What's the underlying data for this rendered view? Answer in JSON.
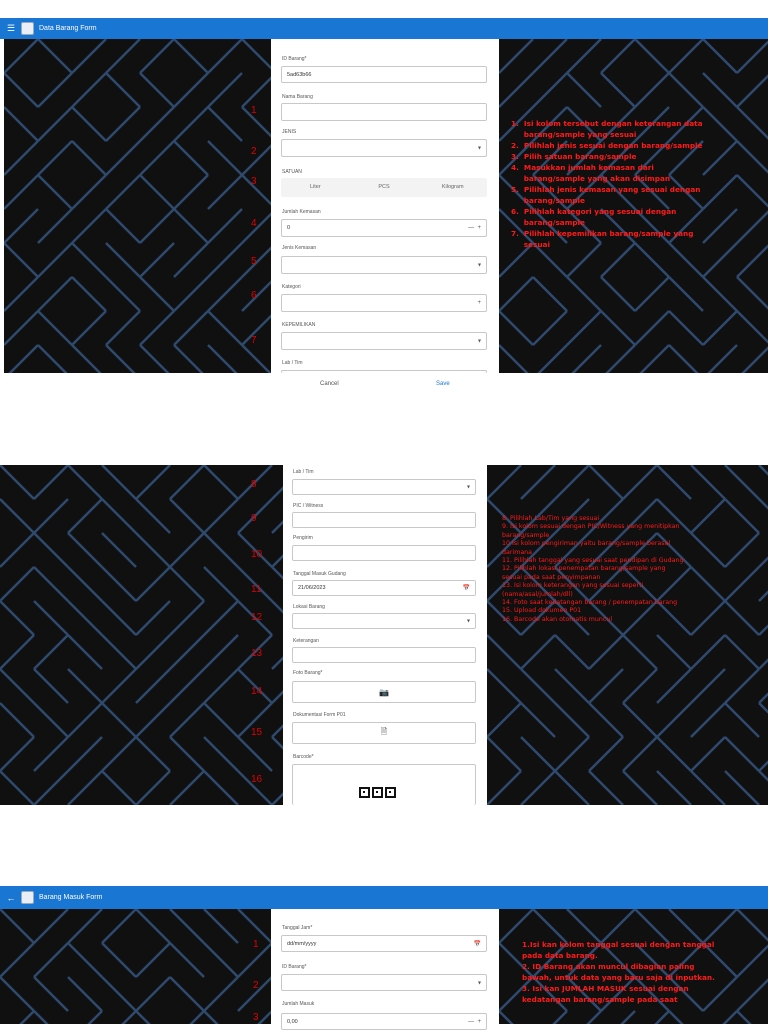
{
  "panel1": {
    "title": "Data Barang Form",
    "labels": {
      "id_barang": "ID Barang*",
      "nama_barang": "Nama Barang",
      "jenis": "JENIS",
      "satuan": "SATUAN",
      "jumlah_kemasan": "Jumlah Kemasan",
      "jenis_kemasan": "Jenis Kemasan",
      "kategori": "Kategori",
      "kepemilikan": "KEPEMILIKAN",
      "lab_tim": "Lab / Tim"
    },
    "values": {
      "id_barang": "5ad63b66",
      "jumlah_kemasan": "0"
    },
    "satuan_options": [
      "Liter",
      "PCS",
      "Kilogram"
    ],
    "actions": {
      "cancel": "Cancel",
      "save": "Save"
    },
    "numbers": [
      "1",
      "2",
      "3",
      "4",
      "5",
      "6",
      "7"
    ],
    "notes": [
      "1.  Isi kolom tersebut dengan keterangan data\n     barang/sample yang sesuai",
      "2.  Pilihlah jenis sesuai dengan barang/sample",
      "3.  Pilih satuan barang/sample",
      "4.  Masukkan jumlah kemasan dari\n     barang/sample yang akan disimpan",
      "5.  Pilihlah jenis kemasan yang sesuai dengan\n     barang/sample",
      "6.  Pilihlah kategori yang sesuai dengan\n     barang/sample",
      "7.  Pilihlah kepemilikan barang/sample yang\n     sesuai"
    ]
  },
  "panel2": {
    "labels": {
      "lab_tim": "Lab / Tim",
      "pic": "PIC / Witness",
      "pengirim": "Pengirim",
      "tanggal": "Tanggal Masuk Gudang",
      "lokasi": "Lokasi Barang",
      "keterangan": "Keterangan",
      "foto": "Foto Barang*",
      "dokumentasi": "Dokumentasi Form P01",
      "barcode": "Barcode*"
    },
    "values": {
      "tanggal": "21/06/2023"
    },
    "numbers": [
      "8",
      "9",
      "10",
      "11",
      "12",
      "13",
      "14",
      "15",
      "16"
    ],
    "notes": [
      "8. Pilihlah Lab/Tim yang sesuai",
      "9. Isi kolom sesuai dengan PIC/Witness yang menitipkan\nbarang/sample",
      "10 Isi kolom pengiriman yaitu barang/sample berasal\ndarimana",
      "11. Pilihlah tanggal yang sesuai saat pendipan di Gudang",
      "12. Pilihlah lokasi penempatan barang/sample yang\nsesuai pada saat penyimpanan",
      "13. Isi kolom keterangan yang sesuai seperti\n(nama/asal/jumlah/dll)",
      "14. Foto saat kedatangan barang / penempatan barang",
      "15. Upload dokumen P01",
      "16. Barcode akan otomatis muncul"
    ]
  },
  "panel3": {
    "title": "Barang Masuk Form",
    "labels": {
      "tanggal_jam": "Tanggal Jam*",
      "id_barang": "ID Barang*",
      "jumlah_masuk": "Jumlah Masuk"
    },
    "values": {
      "tanggal_jam": "dd/mm/yyyy",
      "jumlah_masuk": "0,00"
    },
    "numbers": [
      "1",
      "2",
      "3"
    ],
    "notes": [
      "1.Isi kan kolom tanggal sesuai dengan tanggal\npada data barang.",
      "2. ID Barang akan muncul dibagian paling\nbawah, untuk data yang baru saja di inputkan.",
      "3. Isi kan JUMLAH MASUK sesuai dengan\nkedatangan barang/sample pada saat"
    ]
  },
  "colors": {
    "appbar": "#1976d2",
    "note_red": "#ff1a1a",
    "save_blue": "#1976d2"
  },
  "icons": [
    "menu-icon",
    "back-arrow-icon",
    "app-logo-icon",
    "chevron-down-icon",
    "plus-icon",
    "minus-icon",
    "calendar-icon",
    "camera-icon",
    "document-icon",
    "qr-code-icon"
  ]
}
